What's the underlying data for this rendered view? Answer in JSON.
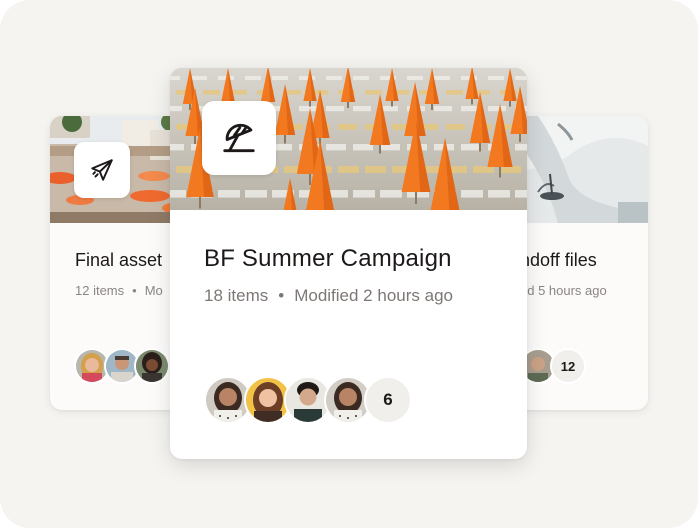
{
  "cards": {
    "left": {
      "title": "Final asset",
      "items": "12 items",
      "modified": "Mo",
      "icon": "paper-plane-icon"
    },
    "center": {
      "title": "BF Summer Campaign",
      "items": "18 items",
      "modified": "Modified 2 hours ago",
      "icon": "beach-umbrella-icon",
      "member_overflow": "6"
    },
    "right": {
      "title": "ndoff files",
      "modified": "ed 5 hours ago",
      "member_overflow": "12"
    }
  },
  "colors": {
    "background": "#f5f4f1",
    "card": "#ffffff",
    "title_text": "#1e1919",
    "meta_text": "#8a8583",
    "umbrella_orange": "#f2791f"
  }
}
